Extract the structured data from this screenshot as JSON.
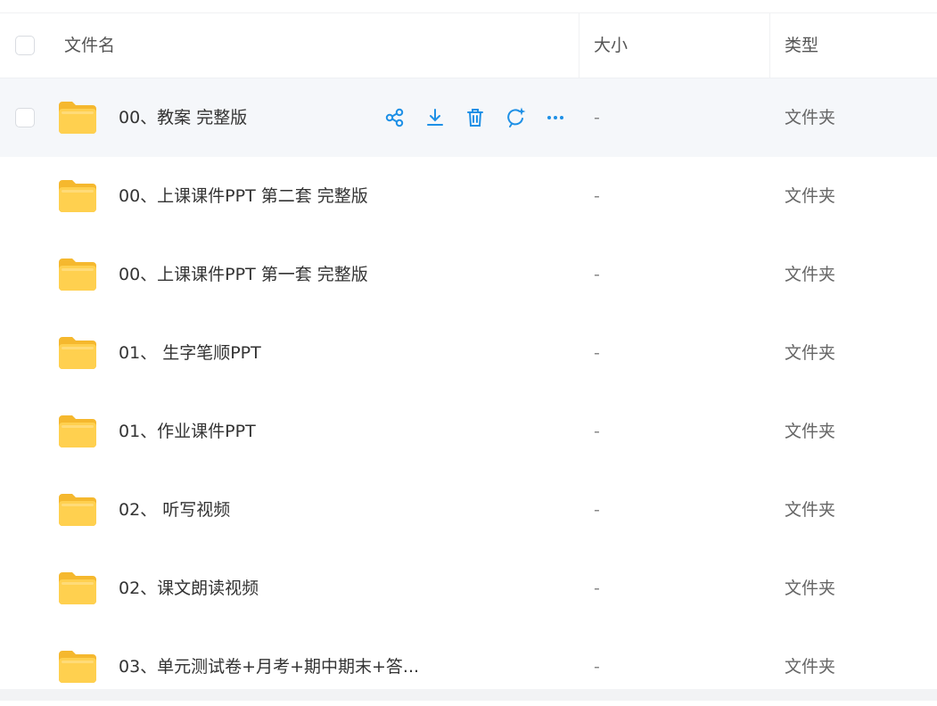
{
  "header": {
    "name": "文件名",
    "size": "大小",
    "type": "类型"
  },
  "accent": "#1e90e6",
  "folder_color": "#ffc83d",
  "row_actions": [
    "share-icon",
    "download-icon",
    "delete-icon",
    "ai-assistant-icon",
    "more-icon"
  ],
  "files": [
    {
      "name": "00、教案 完整版",
      "size": "-",
      "type": "文件夹"
    },
    {
      "name": "00、上课课件PPT 第二套 完整版",
      "size": "-",
      "type": "文件夹"
    },
    {
      "name": "00、上课课件PPT 第一套 完整版",
      "size": "-",
      "type": "文件夹"
    },
    {
      "name": "01、 生字笔顺PPT",
      "size": "-",
      "type": "文件夹"
    },
    {
      "name": "01、作业课件PPT",
      "size": "-",
      "type": "文件夹"
    },
    {
      "name": "02、 听写视频",
      "size": "-",
      "type": "文件夹"
    },
    {
      "name": "02、课文朗读视频",
      "size": "-",
      "type": "文件夹"
    },
    {
      "name": "03、单元测试卷+月考+期中期末+答...",
      "size": "-",
      "type": "文件夹"
    }
  ]
}
